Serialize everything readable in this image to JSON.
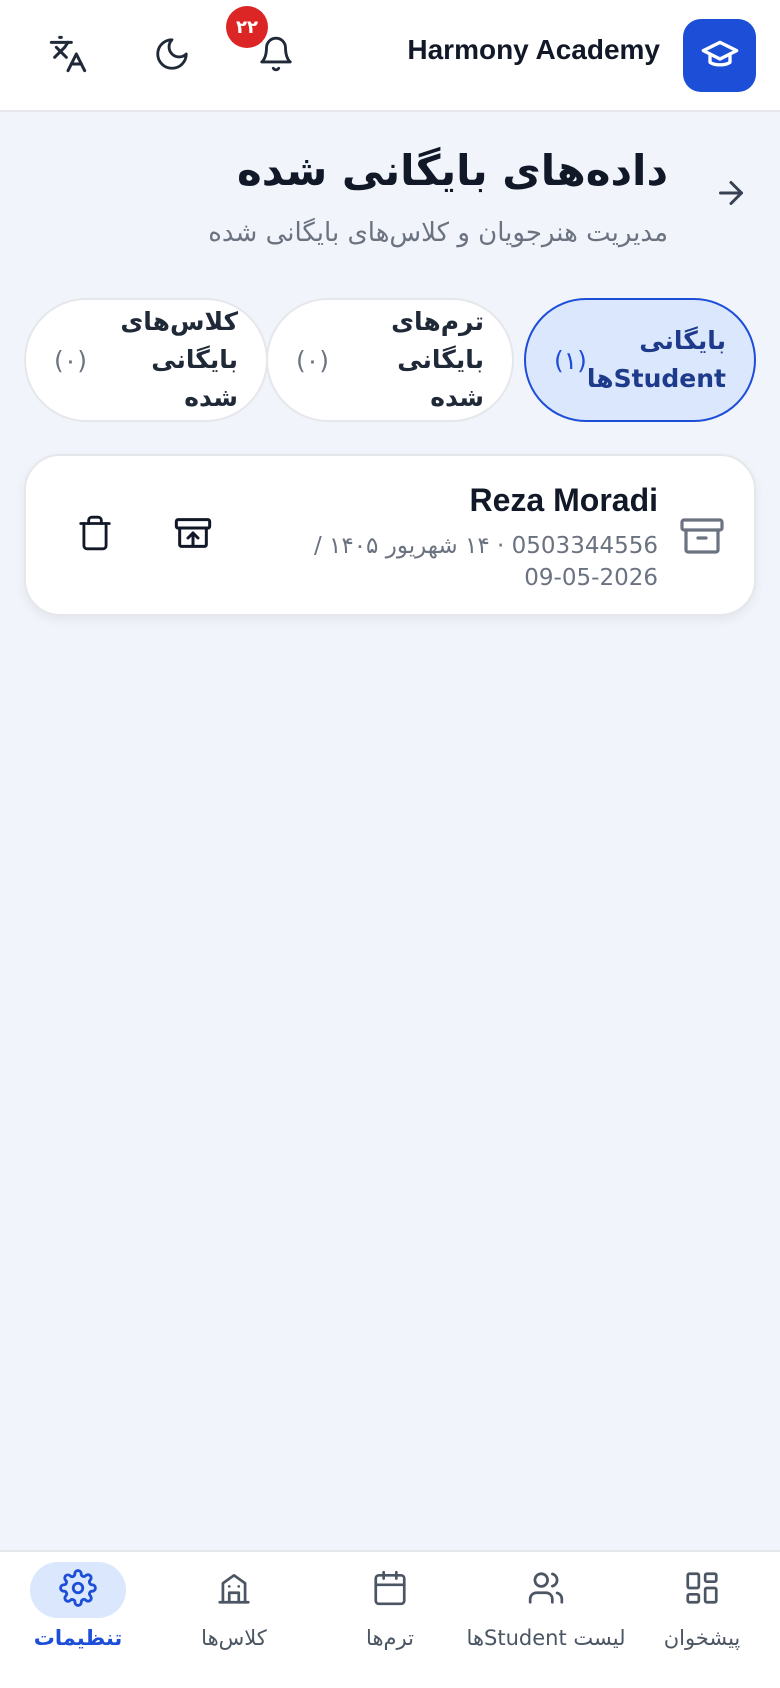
{
  "app": {
    "title": "Harmony Academy",
    "notification_count": "۲۲"
  },
  "colors": {
    "accent": "#1d4ed8",
    "badge": "#dc2626",
    "active_bg": "#dbe7fd",
    "background": "#f1f4fb"
  },
  "icons": {
    "logo": "graduation-cap-icon",
    "notifications": "bell-icon",
    "theme": "moon-icon",
    "language": "translate-icon",
    "back": "arrow-right-icon"
  },
  "header": {
    "title": "داده‌های بایگانی شده",
    "subtitle": "مدیریت هنرجویان و کلاس‌های بایگانی شده"
  },
  "tabs": [
    {
      "label": "بایگانی Studentها",
      "count": "(۱)",
      "active": true
    },
    {
      "label": "ترم‌های بایگانی شده",
      "count": "(۰)",
      "active": false
    },
    {
      "label": "کلاس‌های بایگانی شده",
      "count": "(۰)",
      "active": false
    }
  ],
  "students": [
    {
      "name": "Reza Moradi",
      "meta": "0503344556 · ۱۴ شهریور ۱۴۰۵ / 2026-05-09",
      "actions": [
        "restore",
        "delete"
      ]
    }
  ],
  "nav": {
    "items": [
      {
        "label": "پیشخوان",
        "icon": "dashboard-icon",
        "active": false
      },
      {
        "label": "لیست Studentها",
        "icon": "users-icon",
        "active": false
      },
      {
        "label": "ترم‌ها",
        "icon": "calendar-icon",
        "active": false
      },
      {
        "label": "کلاس‌ها",
        "icon": "building-icon",
        "active": false
      },
      {
        "label": "تنظیمات",
        "icon": "settings-icon",
        "active": true
      }
    ]
  }
}
